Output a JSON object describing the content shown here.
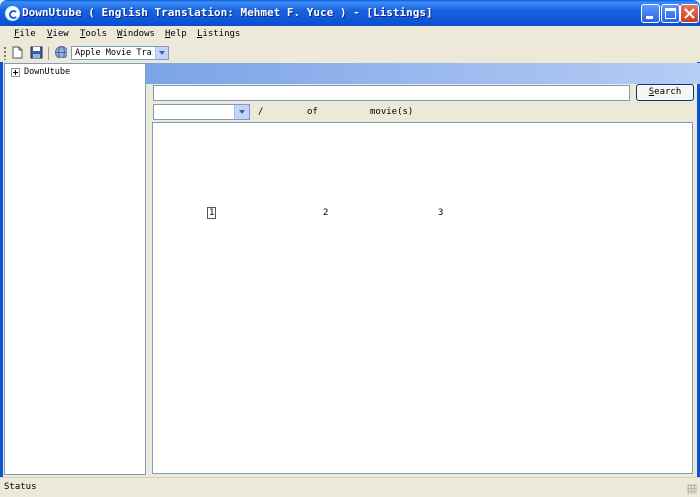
{
  "window": {
    "title": "DownUtube ( English Translation: Mehmet F. Yuce ) - [Listings]",
    "buttons": {
      "minimize": "minimize",
      "maximize": "maximize",
      "close": "close"
    }
  },
  "menu": {
    "items": [
      "File",
      "View",
      "Tools",
      "Windows",
      "Help",
      "Listings"
    ]
  },
  "toolbar": {
    "source_value": "Apple Movie Trailers",
    "source_visible": "Apple Movie Trai:"
  },
  "tree": {
    "root_label": "DownUtube"
  },
  "search": {
    "value": "",
    "button_label": "Search"
  },
  "pager": {
    "selected_page": "",
    "slash": "/",
    "of_label": "of",
    "count_label": "movie(s)",
    "pages": [
      "1",
      "2",
      "3"
    ],
    "current_page": "1"
  },
  "status": {
    "text": "Status"
  },
  "colors": {
    "title_bar": "#0b52d4",
    "header_gradient_start": "#7ba3e8",
    "close_button": "#c8401c"
  }
}
